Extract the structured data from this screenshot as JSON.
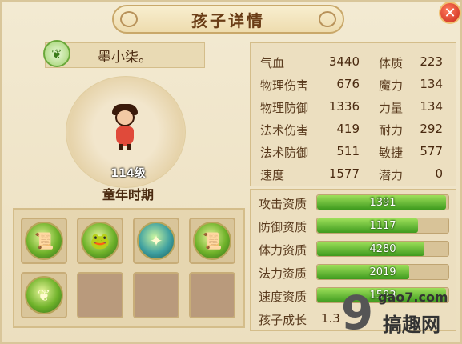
{
  "window": {
    "title": "孩子详情",
    "close_glyph": "✕"
  },
  "child": {
    "name": "墨小柒。",
    "level": "114级",
    "stage": "童年时期"
  },
  "stats": [
    {
      "label": "气血",
      "value": "3440"
    },
    {
      "label": "物理伤害",
      "value": "676"
    },
    {
      "label": "物理防御",
      "value": "1336"
    },
    {
      "label": "法术伤害",
      "value": "419"
    },
    {
      "label": "法术防御",
      "value": "511"
    },
    {
      "label": "速度",
      "value": "1577"
    }
  ],
  "attributes": [
    {
      "label": "体质",
      "value": "223"
    },
    {
      "label": "魔力",
      "value": "134"
    },
    {
      "label": "力量",
      "value": "134"
    },
    {
      "label": "耐力",
      "value": "292"
    },
    {
      "label": "敏捷",
      "value": "577"
    },
    {
      "label": "潜力",
      "value": "0"
    }
  ],
  "aptitudes": [
    {
      "label": "攻击资质",
      "value": "1391",
      "fill": 0.98
    },
    {
      "label": "防御资质",
      "value": "1117",
      "fill": 0.77
    },
    {
      "label": "体力资质",
      "value": "4280",
      "fill": 0.82
    },
    {
      "label": "法力资质",
      "value": "2019",
      "fill": 0.7
    },
    {
      "label": "速度资质",
      "value": "1583",
      "fill": 0.98
    }
  ],
  "growth": {
    "label": "孩子成长",
    "value": "1.3"
  },
  "skills": [
    {
      "icon": "scroll-skill-icon",
      "glyph": "📜",
      "style": "green"
    },
    {
      "icon": "frog-skill-icon",
      "glyph": "🐸",
      "style": "green"
    },
    {
      "icon": "beetle-skill-icon",
      "glyph": "✦",
      "style": "blue"
    },
    {
      "icon": "scroll-skill-icon",
      "glyph": "📜",
      "style": "green"
    },
    {
      "icon": "leaf-skill-icon",
      "glyph": "❦",
      "style": "green"
    }
  ],
  "watermark": {
    "logo": "9",
    "site": "gao7.com",
    "name": "搞趣网"
  },
  "colors": {
    "accent": "#c9a86a",
    "bar": "#4aa824",
    "close": "#c8281a"
  }
}
